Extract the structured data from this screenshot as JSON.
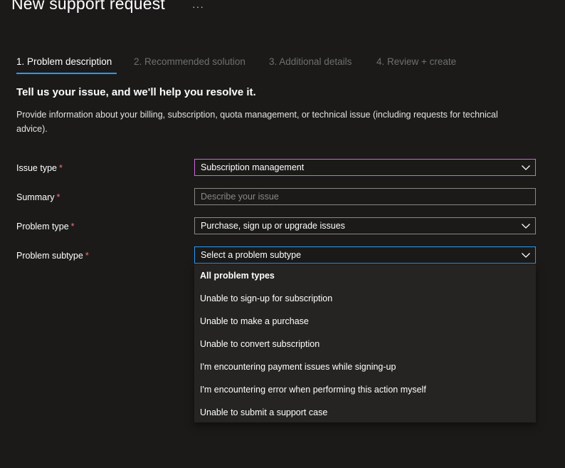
{
  "page": {
    "title": "New support request",
    "more_icon": "more-ellipsis-icon",
    "more_glyph": "···"
  },
  "tabs": [
    {
      "label": "1. Problem description",
      "active": true
    },
    {
      "label": "2. Recommended solution",
      "active": false
    },
    {
      "label": "3. Additional details",
      "active": false
    },
    {
      "label": "4. Review + create",
      "active": false
    }
  ],
  "form": {
    "heading": "Tell us your issue, and we'll help you resolve it.",
    "description": "Provide information about your billing, subscription, quota management, or technical issue (including requests for technical advice).",
    "required_marker": "*",
    "issue_type": {
      "label": "Issue type",
      "value": "Subscription management"
    },
    "summary": {
      "label": "Summary",
      "placeholder": "Describe your issue",
      "value": ""
    },
    "problem_type": {
      "label": "Problem type",
      "value": "Purchase, sign up or upgrade issues"
    },
    "problem_subtype": {
      "label": "Problem subtype",
      "placeholder": "Select a problem subtype"
    }
  },
  "dropdown": {
    "header": "All problem types",
    "options": [
      "Unable to sign-up for subscription",
      "Unable to make a purchase",
      "Unable to convert subscription",
      "I'm encountering payment issues while signing-up",
      "I'm encountering error when performing this action myself",
      "Unable to submit a support case"
    ]
  },
  "colors": {
    "background": "#1b1a19",
    "accent": "#2899f5",
    "required": "#f1707b",
    "focus_purple": "#c76bd8",
    "dropdown_bg": "#252423"
  },
  "icons": {
    "chevron": "chevron-down-icon"
  }
}
